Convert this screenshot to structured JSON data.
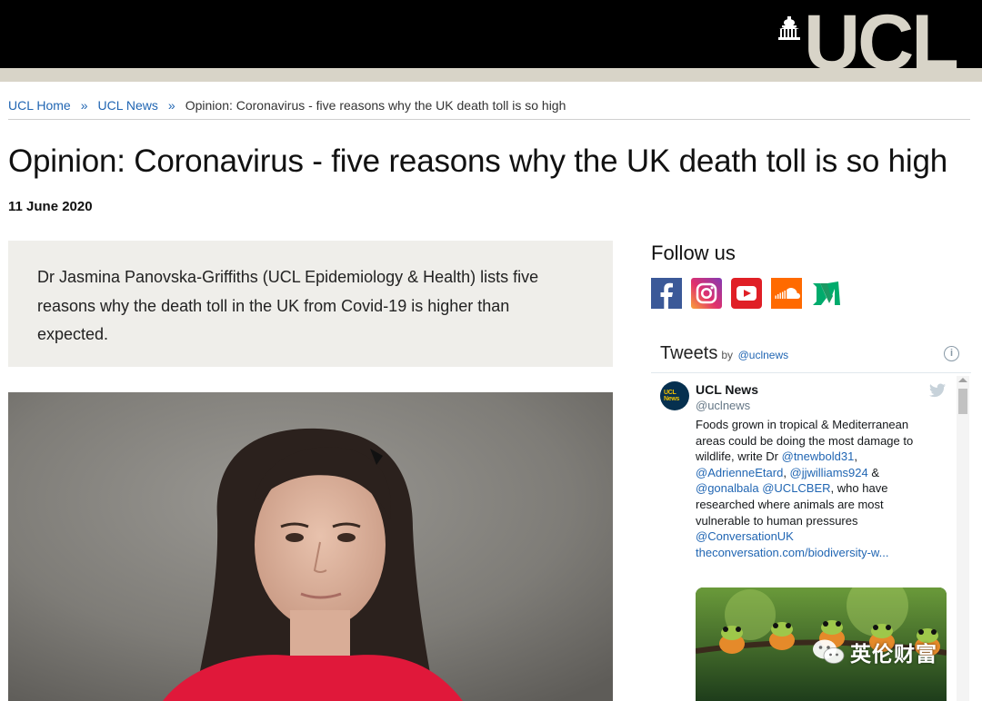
{
  "header": {
    "logo_text": "UCL"
  },
  "breadcrumb": {
    "items": [
      "UCL Home",
      "UCL News"
    ],
    "separator": "»",
    "current": "Opinion: Coronavirus - five reasons why the UK death toll is so high"
  },
  "article": {
    "title": "Opinion: Coronavirus - five reasons why the UK death toll is so high",
    "date": "11 June 2020",
    "standfirst": "Dr Jasmina Panovska-Griffiths (UCL Epidemiology & Health) lists five reasons why the death toll in the UK from Covid-19 is higher than expected."
  },
  "sidebar": {
    "follow_title": "Follow us",
    "social_icons": [
      "facebook-icon",
      "instagram-icon",
      "youtube-icon",
      "soundcloud-icon",
      "medium-icon"
    ],
    "tweets": {
      "heading": "Tweets",
      "by": "by",
      "handle_link": "@uclnews",
      "info": "i",
      "tweet": {
        "avatar_text": "UCL News",
        "name": "UCL News",
        "handle": "@uclnews",
        "text_1": "Foods grown in tropical & Mediterranean areas could be doing the most damage to wildlife, write Dr ",
        "mention_1": "@tnewbold31",
        "text_2": ", ",
        "mention_2": "@AdrienneEtard",
        "text_3": ", ",
        "mention_3": "@jjwilliams924",
        "text_4": " & ",
        "mention_4": "@gonalbala",
        "text_5": " ",
        "mention_5": "@UCLCBER",
        "text_6": ", who have researched where animals are most vulnerable to human pressures ",
        "mention_6": "@ConversationUK",
        "text_7": " ",
        "link": "theconversation.com/biodiversity-w..."
      }
    }
  },
  "watermark": {
    "text": "英伦财富"
  },
  "colors": {
    "header_bg": "#000000",
    "header_band": "#d8d4c8",
    "link": "#2166b3",
    "standfirst_bg": "#efeeea"
  }
}
